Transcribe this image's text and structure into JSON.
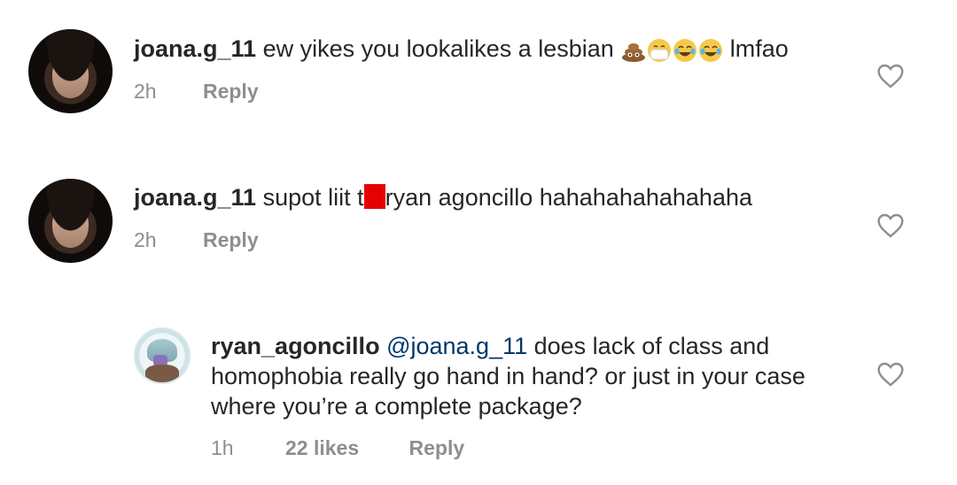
{
  "comments": [
    {
      "username": "joana.g_11",
      "text_before": " ew yikes you lookalikes a lesbian ",
      "emojis": [
        "poop-emoji",
        "mask-emoji",
        "tears-of-joy-emoji",
        "tears-of-joy-emoji"
      ],
      "text_after": " lmfao",
      "time": "2h",
      "reply_label": "Reply"
    },
    {
      "username": "joana.g_11",
      "text_before": " supot liit t",
      "text_after": "ryan agoncillo hahahahahahahaha",
      "time": "2h",
      "reply_label": "Reply"
    },
    {
      "username": "ryan_agoncillo",
      "mention": "@joana.g_11",
      "line1": " does lack of class and",
      "line2": "homophobia really go hand in hand? or just in your case",
      "line3": "where you’re a complete package?",
      "time": "1h",
      "likes": "22 likes",
      "reply_label": "Reply"
    }
  ],
  "colors": {
    "text": "#262626",
    "secondary": "#8e8e8e",
    "mention": "#00376b",
    "redaction": "#e60000"
  },
  "icons": {
    "like": "heart-outline-icon"
  }
}
